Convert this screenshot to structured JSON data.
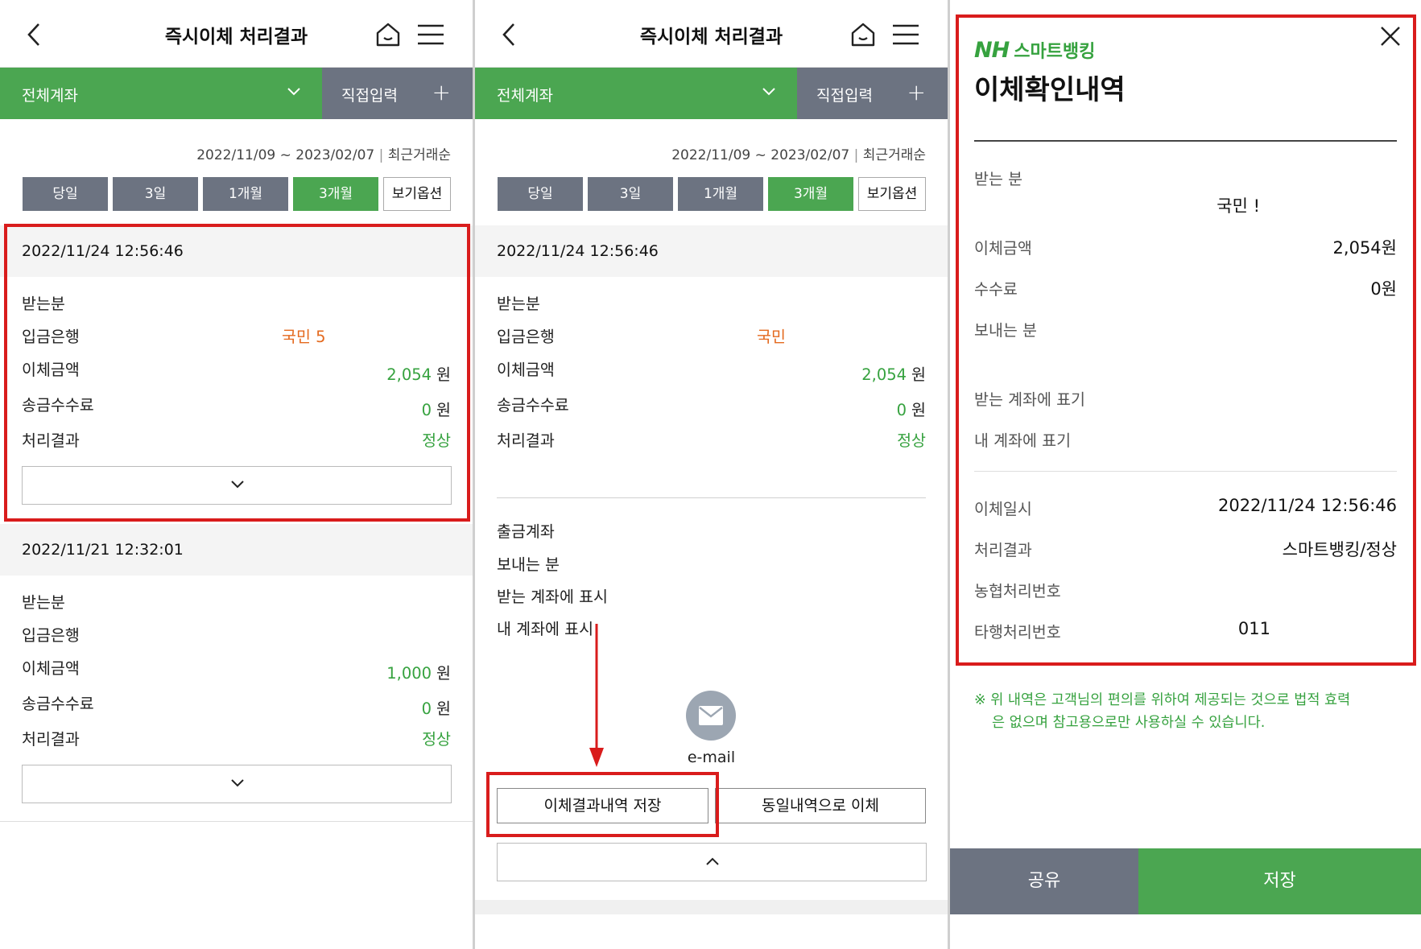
{
  "panel1": {
    "title": "즉시이체 처리결과",
    "tab_all": "전체계좌",
    "tab_direct": "직접입력",
    "range": "2022/11/09 ~ 2023/02/07",
    "sort": "최근거래순",
    "periods": [
      "당일",
      "3일",
      "1개월",
      "3개월"
    ],
    "view_options": "보기옵션",
    "cards": [
      {
        "date": "2022/11/24 12:56:46",
        "recipient_label": "받는분",
        "bank_label": "입금은행",
        "bank_value": "국민 5",
        "amount_label": "이체금액",
        "amount_value": "2,054",
        "fee_label": "송금수수료",
        "fee_value": "0",
        "result_label": "처리결과",
        "result_value": "정상"
      },
      {
        "date": "2022/11/21 12:32:01",
        "recipient_label": "받는분",
        "bank_label": "입금은행",
        "amount_label": "이체금액",
        "amount_value": "1,000",
        "fee_label": "송금수수료",
        "fee_value": "0",
        "result_label": "처리결과",
        "result_value": "정상"
      }
    ],
    "unit": "원"
  },
  "panel2": {
    "title": "즉시이체 처리결과",
    "tab_all": "전체계좌",
    "tab_direct": "직접입력",
    "range": "2022/11/09 ~ 2023/02/07",
    "sort": "최근거래순",
    "periods": [
      "당일",
      "3일",
      "1개월",
      "3개월"
    ],
    "view_options": "보기옵션",
    "card": {
      "date": "2022/11/24 12:56:46",
      "recipient_label": "받는분",
      "bank_label": "입금은행",
      "bank_value": "국민",
      "amount_label": "이체금액",
      "amount_value": "2,054",
      "fee_label": "송금수수료",
      "fee_value": "0",
      "result_label": "처리결과",
      "result_value": "정상",
      "withdraw_label": "출금계좌",
      "sender_label": "보내는 분",
      "show_recipient_label": "받는 계좌에 표시",
      "show_mine_label": "내 계좌에 표시"
    },
    "unit": "원",
    "email_label": "e-mail",
    "save_result_button": "이체결과내역 저장",
    "same_transfer_button": "동일내역으로 이체"
  },
  "panel3": {
    "brand_nh": "NH",
    "brand_sb": "스마트뱅킹",
    "title": "이체확인내역",
    "recipient_label": "받는 분",
    "recipient_value": "국민 !",
    "amount_label": "이체금액",
    "amount_value": "2,054원",
    "fee_label": "수수료",
    "fee_value": "0원",
    "sender_label": "보내는 분",
    "show_recipient_label": "받는 계좌에 표기",
    "show_mine_label": "내 계좌에 표기",
    "datetime_label": "이체일시",
    "datetime_value": "2022/11/24 12:56:46",
    "result_label": "처리결과",
    "result_value": "스마트뱅킹/정상",
    "nh_number_label": "농협처리번호",
    "other_number_label": "타행처리번호",
    "other_number_value": "011",
    "note_line1": "※ 위 내역은 고객님의 편의를 위하여 제공되는 것으로 법적 효력",
    "note_line2": "은 없으며 참고용으로만 사용하실 수 있습니다.",
    "share_button": "공유",
    "save_button": "저장"
  },
  "colors": {
    "green": "#4ba651",
    "gray": "#6c7381",
    "highlight": "#d91c1c",
    "orange": "#e46a1f"
  }
}
